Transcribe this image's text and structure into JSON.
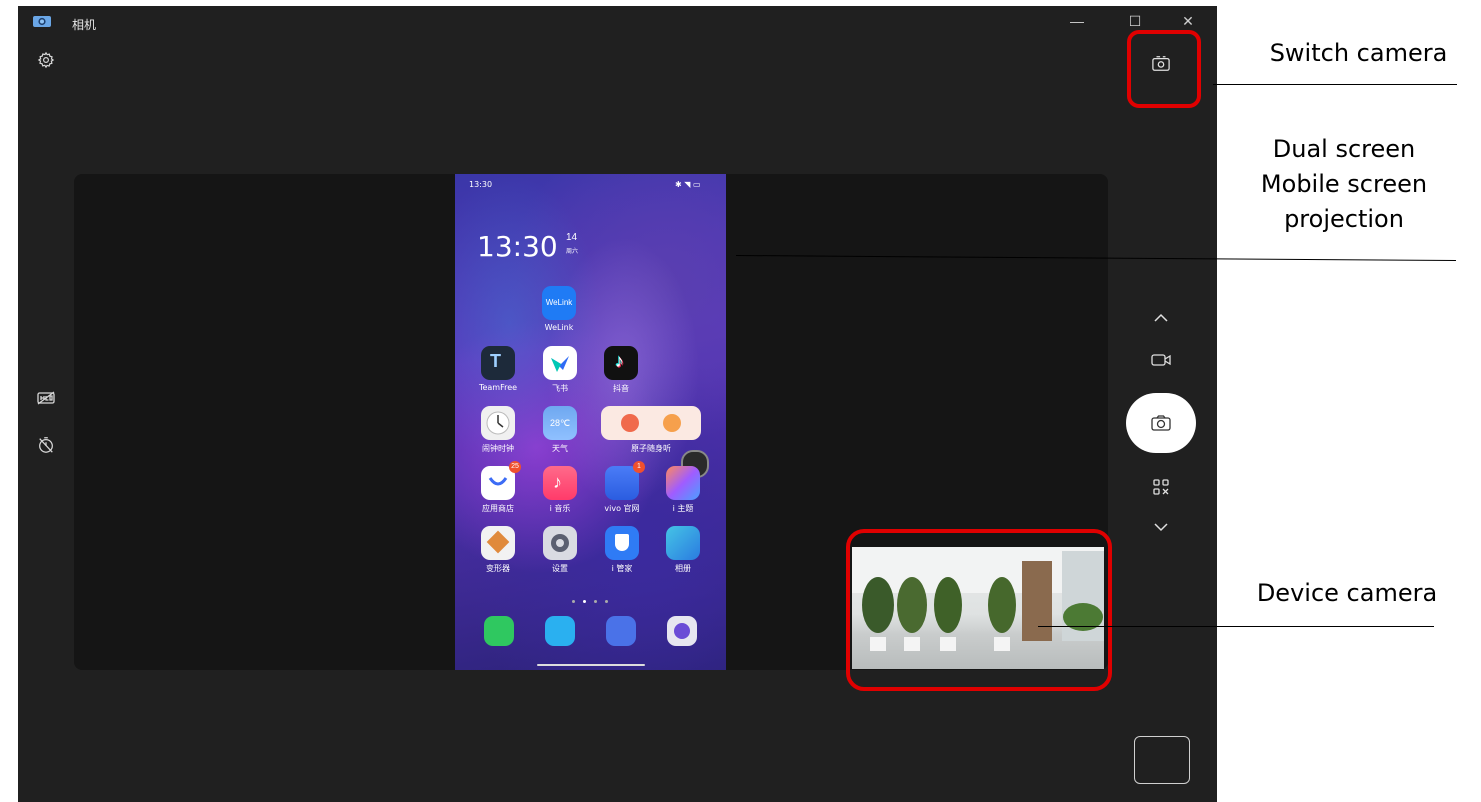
{
  "window": {
    "title": "相机",
    "minimize_glyph": "—",
    "maximize_glyph": "☐",
    "close_glyph": "✕"
  },
  "icons": {
    "app": "camera-app-icon",
    "settings": "gear-icon",
    "hdr": "hdr-off-icon",
    "timer": "timer-off-icon",
    "switch_camera": "switch-camera-icon",
    "mode_up": "chevron-up-icon",
    "video_mode": "video-camera-icon",
    "shutter": "camera-shutter-icon",
    "qr_mode": "qr-code-icon",
    "mode_down": "chevron-down-icon",
    "thumbnail": "last-photo-thumbnail"
  },
  "phone": {
    "status_time": "13:30",
    "clock": "13:30",
    "date_day": "14",
    "date_week": "周六",
    "apps": [
      {
        "label": "WeLink",
        "badge": ""
      },
      {
        "label": "TeamFree",
        "badge": ""
      },
      {
        "label": "飞书",
        "badge": ""
      },
      {
        "label": "抖音",
        "badge": ""
      },
      {
        "label": "闹钟时钟",
        "badge": ""
      },
      {
        "label": "天气",
        "badge": ""
      },
      {
        "label": "原子随身听",
        "badge": ""
      },
      {
        "label": "应用商店",
        "badge": "25"
      },
      {
        "label": "i 音乐",
        "badge": ""
      },
      {
        "label": "vivo 官网",
        "badge": "1"
      },
      {
        "label": "i 主题",
        "badge": ""
      },
      {
        "label": "变形器",
        "badge": ""
      },
      {
        "label": "设置",
        "badge": ""
      },
      {
        "label": "i 管家",
        "badge": ""
      },
      {
        "label": "相册",
        "badge": ""
      }
    ],
    "weather_icon_text": "28℃",
    "welink_icon_text": "WeLink"
  },
  "annotations": {
    "switch_camera": "Switch camera",
    "dual_screen_line1": "Dual screen",
    "dual_screen_line2": "Mobile screen",
    "dual_screen_line3": "projection",
    "device_camera": "Device camera"
  },
  "colors": {
    "window_bg": "#202020",
    "highlight_red": "#e00000",
    "shutter_bg": "#ffffff"
  }
}
